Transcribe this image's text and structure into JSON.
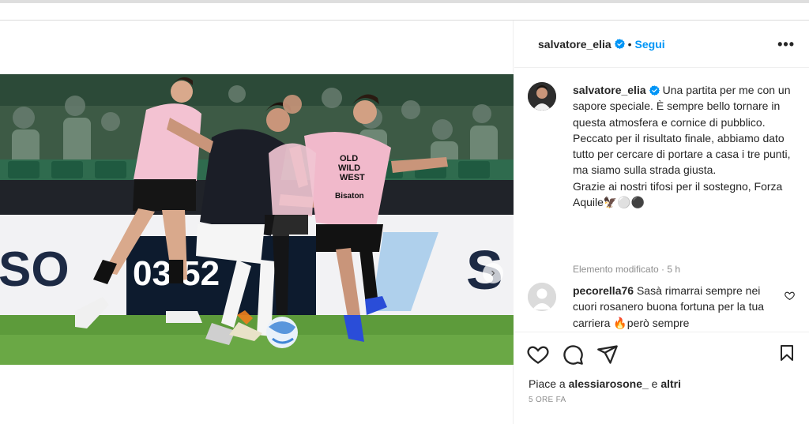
{
  "post": {
    "username": "salvatore_elia",
    "separator": "•",
    "follow_label": "Segui",
    "more_label": "•••"
  },
  "caption": {
    "username": "salvatore_elia",
    "text": "Una partita per me con un sapore speciale. È sempre bello tornare in questa atmosfera e cornice di pubblico.",
    "text2": "Peccato per il risultato finale, abbiamo dato tutto per cercare di portare a casa i tre punti, ma siamo sulla strada giusta.",
    "text3": "Grazie ai nostri tifosi per il sostegno, Forza Aquile",
    "emojis": "🦅⚪⚫",
    "edited": "Elemento modificato · 5 h"
  },
  "comment": {
    "username": "pecorella76",
    "text": "Sasà rimarrai sempre nei cuori rosanero buona fortuna per la tua carriera",
    "text_emoji": "🔥",
    "text_tail": "però sempre"
  },
  "likes": {
    "prefix": "Piace a",
    "user": "alessiarosone_",
    "middle": "e",
    "others": "altri"
  },
  "timestamp": "5 ORE FA",
  "photo": {
    "board_text_left": "SO",
    "board_number": "03 52",
    "board_text_right": "S",
    "jersey_text": "OLD WILD WEST",
    "sponsor": "Bisaton"
  },
  "carousel": {
    "next_icon": "›",
    "slide_count": 3,
    "active_index": 0
  },
  "colors": {
    "accent": "#0095f6",
    "verified": "#0095f6",
    "muted": "#8e8e8e"
  }
}
